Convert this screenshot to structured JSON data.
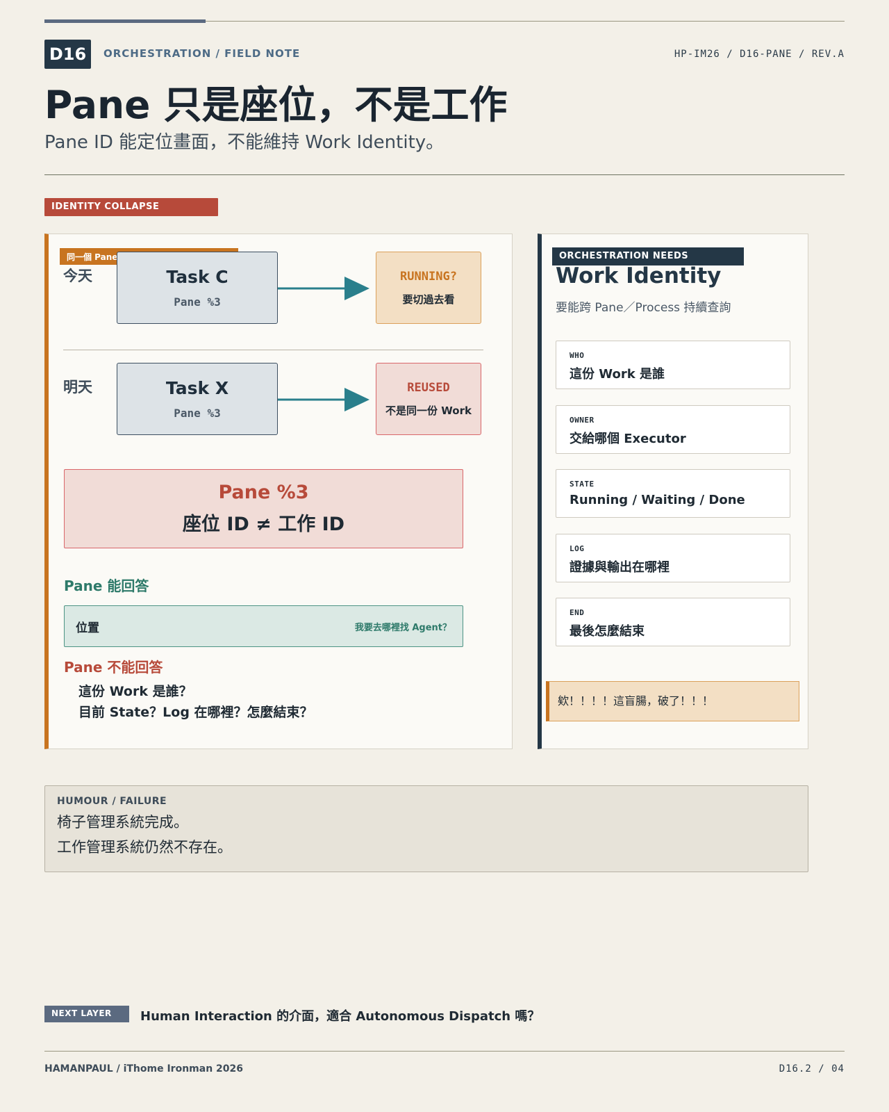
{
  "header": {
    "badge": "D16",
    "kicker": "ORCHESTRATION / FIELD NOTE",
    "docref": "HP-IM26 / D16-PANE / REV.A",
    "title": "Pane 只是座位，不是工作",
    "subtitle": "Pane ID 能定位畫面，不能維持 Work Identity。"
  },
  "left": {
    "tag": "IDENTITY COLLAPSE",
    "pane_tag": "同一個 Pane",
    "rows": [
      {
        "day": "今天",
        "task": "Task C",
        "pane": "Pane  %3",
        "status": "RUNNING?",
        "note": "要切過去看"
      },
      {
        "day": "明天",
        "task": "Task X",
        "pane": "Pane  %3",
        "status": "REUSED",
        "note": "不是同一份 Work"
      }
    ],
    "pane_box": {
      "line1": "Pane  %3",
      "line2": "座位 ID ≠ 工作 ID"
    },
    "can_heading": "Pane 能回答",
    "can_left": "位置",
    "can_right": "我要去哪裡找 Agent？",
    "cannot_heading": "Pane 不能回答",
    "cannot_lines": [
      "這份 Work 是誰？",
      "目前 State？Log 在哪裡？怎麼結束？"
    ]
  },
  "right": {
    "tag": "ORCHESTRATION NEEDS",
    "title": "Work Identity",
    "subtitle": "要能跨 Pane／Process 持續查詢",
    "fields": [
      {
        "key": "WHO",
        "value": "這份 Work 是誰"
      },
      {
        "key": "OWNER",
        "value": "交給哪個 Executor"
      },
      {
        "key": "STATE",
        "value": "Running / Waiting / Done"
      },
      {
        "key": "LOG",
        "value": "證據與輸出在哪裡"
      },
      {
        "key": "END",
        "value": "最後怎麼結束"
      }
    ],
    "joke": "欸！！！！這盲腸，破了！！！"
  },
  "humour": {
    "label": "HUMOUR / FAILURE",
    "lines": [
      "椅子管理系統完成。",
      "工作管理系統仍然不存在。"
    ]
  },
  "next": {
    "tag": "NEXT LAYER",
    "text": "Human Interaction 的介面，適合 Autonomous Dispatch 嗎？"
  },
  "footer": {
    "left": "HAMANPAUL / iThome Ironman 2026",
    "right": "D16.2 / 04"
  },
  "colors": {
    "background": "#f3f0e8",
    "navy": "#243746",
    "orange": "#c87420",
    "red": "#b74a3a",
    "teal": "#2e7a6a",
    "arrow": "#2a7f8c"
  },
  "icons": [
    "arrow-right-icon"
  ]
}
